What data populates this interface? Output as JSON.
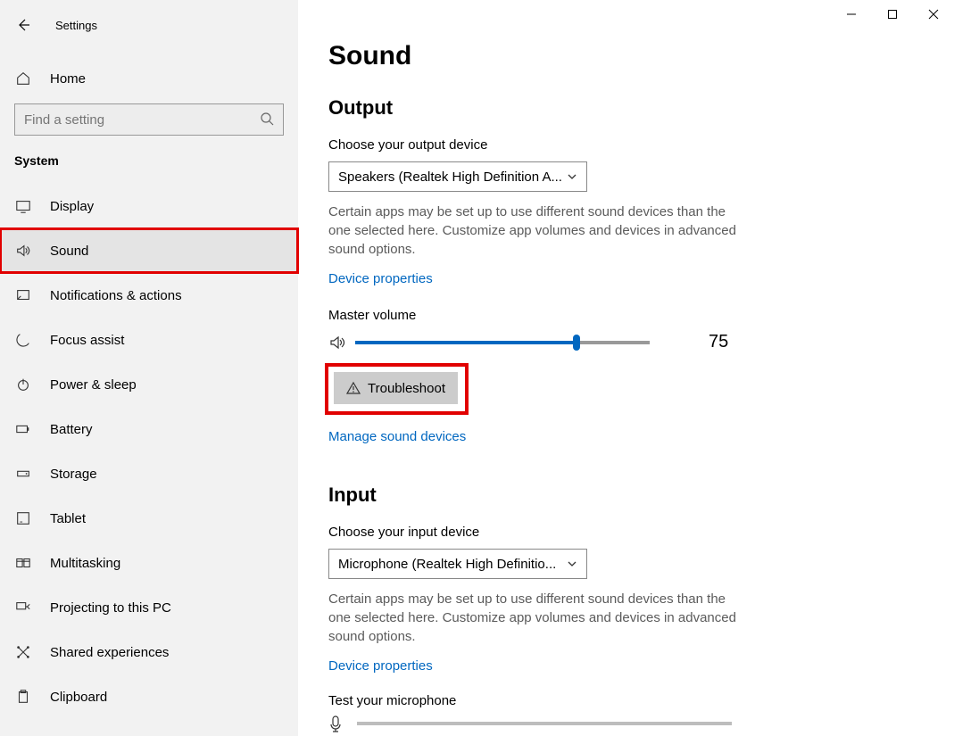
{
  "window": {
    "title": "Settings"
  },
  "sidebar": {
    "home": "Home",
    "searchPlaceholder": "Find a setting",
    "section": "System",
    "items": [
      {
        "label": "Display"
      },
      {
        "label": "Sound"
      },
      {
        "label": "Notifications & actions"
      },
      {
        "label": "Focus assist"
      },
      {
        "label": "Power & sleep"
      },
      {
        "label": "Battery"
      },
      {
        "label": "Storage"
      },
      {
        "label": "Tablet"
      },
      {
        "label": "Multitasking"
      },
      {
        "label": "Projecting to this PC"
      },
      {
        "label": "Shared experiences"
      },
      {
        "label": "Clipboard"
      }
    ]
  },
  "main": {
    "pageTitle": "Sound",
    "output": {
      "heading": "Output",
      "chooseLabel": "Choose your output device",
      "deviceSelected": "Speakers (Realtek High Definition A...",
      "helpText": "Certain apps may be set up to use different sound devices than the one selected here. Customize app volumes and devices in advanced sound options.",
      "deviceProps": "Device properties",
      "masterLabel": "Master volume",
      "masterValue": "75",
      "troubleshoot": "Troubleshoot",
      "manage": "Manage sound devices"
    },
    "input": {
      "heading": "Input",
      "chooseLabel": "Choose your input device",
      "deviceSelected": "Microphone (Realtek High Definitio...",
      "helpText": "Certain apps may be set up to use different sound devices than the one selected here. Customize app volumes and devices in advanced sound options.",
      "deviceProps": "Device properties",
      "testLabel": "Test your microphone"
    }
  }
}
